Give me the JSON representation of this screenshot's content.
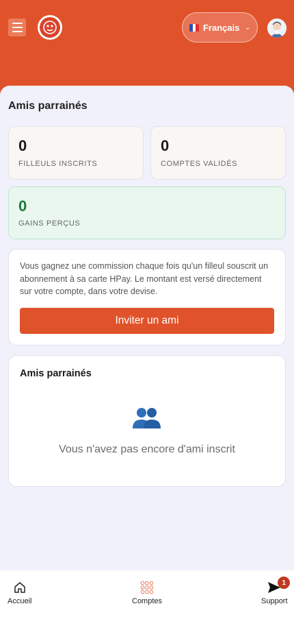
{
  "header": {
    "language": {
      "label": "Français",
      "flag": "fr-flag-icon"
    },
    "colors": {
      "brand": "#e0532a",
      "accent_green": "#1e7a3c"
    }
  },
  "referrals": {
    "section_title": "Amis parrainés",
    "stats": [
      {
        "value": "0",
        "label": "FILLEULS INSCRITS"
      },
      {
        "value": "0",
        "label": "COMPTES VALIDÉS"
      },
      {
        "value": "0",
        "label": "GAINS PERÇUS"
      }
    ],
    "info": {
      "description": "Vous gagnez une commission chaque fois qu'un filleul souscrit un abonnement à sa carte HPay. Le montant est versé directement sur votre compte, dans votre devise.",
      "invite_label": "Inviter un ami"
    },
    "list": {
      "title": "Amis parrainés",
      "empty_icon": "people-icon",
      "empty_text": "Vous n'avez pas encore d'ami inscrit"
    }
  },
  "bottom_nav": {
    "items": [
      {
        "label": "Accueil",
        "icon": "home-icon"
      },
      {
        "label": "Comptes",
        "icon": "grid-icon"
      },
      {
        "label": "Support",
        "icon": "send-icon",
        "badge": "1"
      }
    ]
  }
}
